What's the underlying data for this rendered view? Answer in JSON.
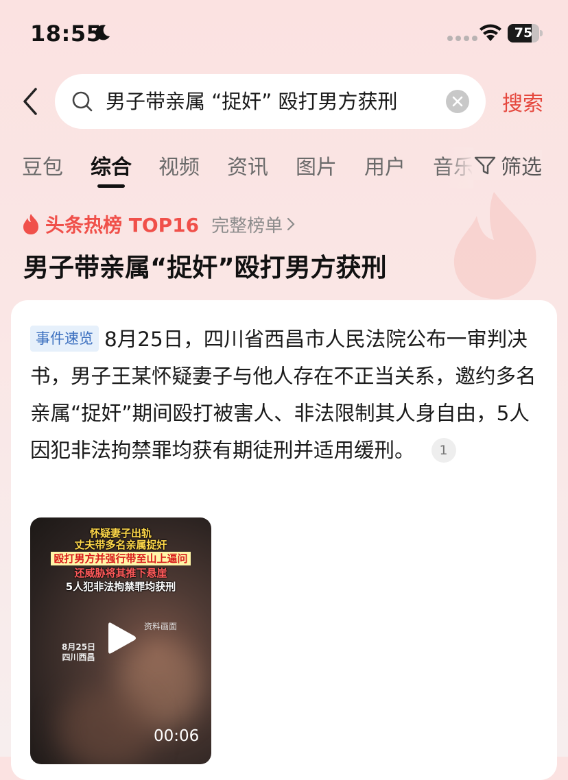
{
  "status_bar": {
    "time": "18:55",
    "battery": "75",
    "battery_level": 0.75
  },
  "search": {
    "query": "男子带亲属 “捉奸” 殴打男方获刑",
    "submit_label": "搜索"
  },
  "tabs": [
    {
      "label": "豆包"
    },
    {
      "label": "综合"
    },
    {
      "label": "视频"
    },
    {
      "label": "资讯"
    },
    {
      "label": "图片"
    },
    {
      "label": "用户"
    },
    {
      "label": "音乐"
    }
  ],
  "filter_label": "筛选",
  "hot_list": {
    "label": "头条热榜 TOP16",
    "full_list_label": "完整榜单",
    "topic_title": "男子带亲属“捉奸”殴打男方获刑"
  },
  "event": {
    "badge": "事件速览",
    "text": "8月25日，四川省西昌市人民法院公布一审判决书，男子王某怀疑妻子与他人存在不正当关系，邀约多名亲属“捉奸”期间殴打被害人、非法限制其人身自由，5人因犯非法拘禁罪均获有期徒刑并适用缓刑。",
    "ref_count": "1"
  },
  "video": {
    "caption_line1": "怀疑妻子出轨",
    "caption_line2": "丈夫带多名亲属捉奸",
    "caption_line3": "殴打男方并强行带至山上逼问",
    "caption_line4": "还威胁将其推下悬崖",
    "caption_line5": "5人犯非法拘禁罪均获刑",
    "watermark": "资料画面",
    "date_line1": "8月25日",
    "date_line2": "四川西昌",
    "duration": "00:06"
  }
}
